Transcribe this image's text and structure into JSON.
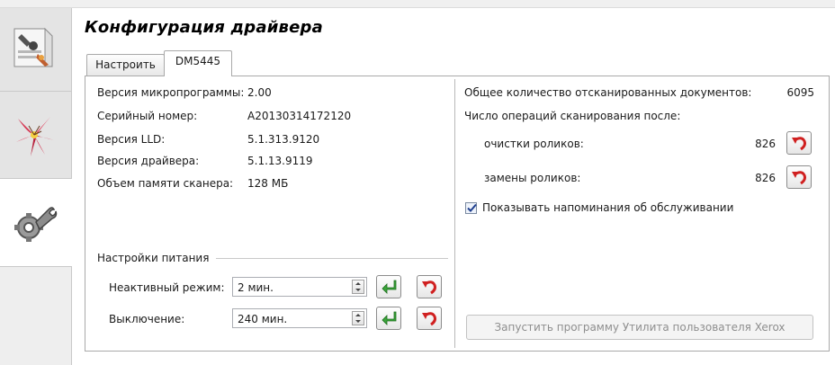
{
  "title": "Конфигурация драйвера",
  "tabs": [
    {
      "label": "Настроить"
    },
    {
      "label": "DM5445"
    }
  ],
  "rail": {
    "items": [
      {
        "icon": "document-settings-icon"
      },
      {
        "icon": "lily-flower-icon"
      },
      {
        "icon": "wrench-gear-icon"
      }
    ]
  },
  "info": {
    "firmware_label": "Версия микропрограммы:",
    "firmware_value": "2.00",
    "serial_label": "Серийный номер:",
    "serial_value": "A20130314172120",
    "lld_label": "Версия LLD:",
    "lld_value": "5.1.313.9120",
    "driver_label": "Версия драйвера:",
    "driver_value": "5.1.13.9119",
    "memory_label": "Объем памяти сканера:",
    "memory_value": "128 МБ"
  },
  "power": {
    "group_label": "Настройки питания",
    "sleep_label": "Неактивный режим:",
    "sleep_value": "2 мин.",
    "off_label": "Выключение:",
    "off_value": "240 мин."
  },
  "counters": {
    "total_label": "Общее количество отсканированных документов:",
    "total_value": "6095",
    "since_label": "Число операций сканирования после:",
    "clean_label": "очистки роликов:",
    "clean_value": "826",
    "replace_label": "замены роликов:",
    "replace_value": "826"
  },
  "reminder": {
    "label": "Показывать напоминания об обслуживании",
    "checked": true
  },
  "utility_button": "Запустить программу Утилита пользователя Xerox"
}
